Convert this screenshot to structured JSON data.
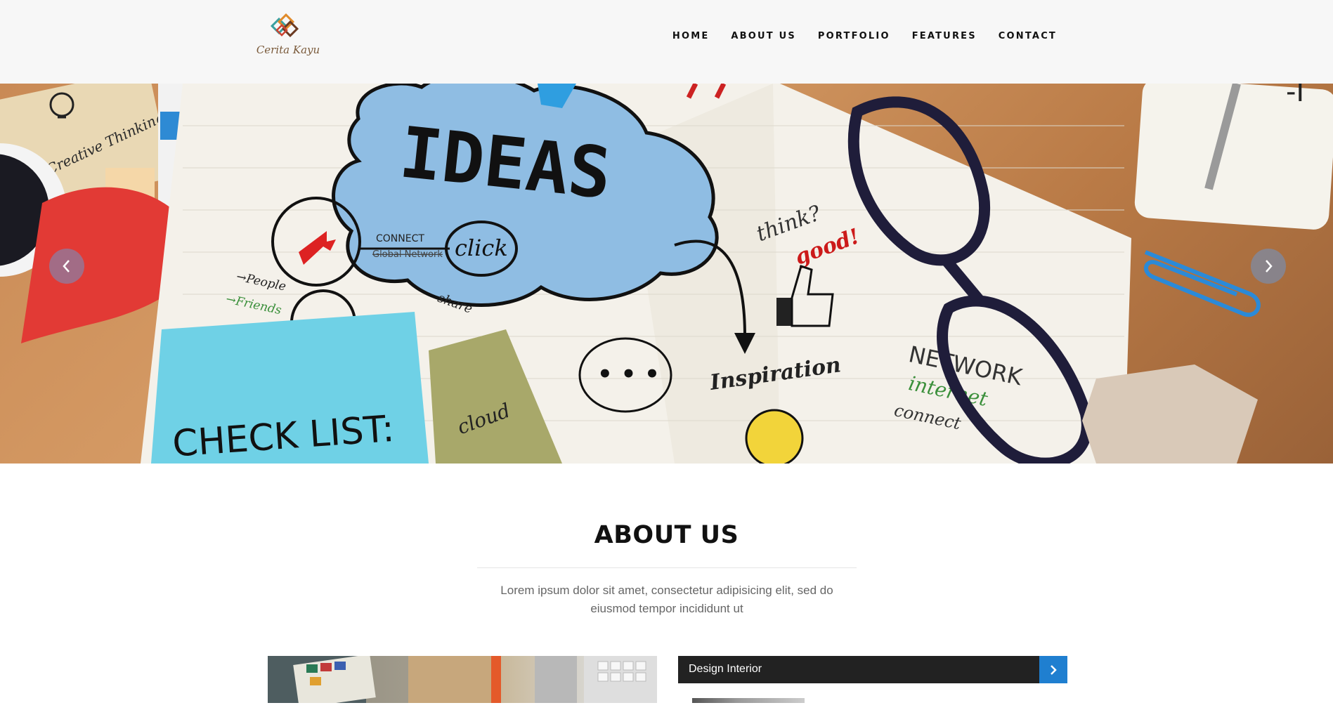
{
  "brand": {
    "name": "Cerita Kayu",
    "logo_icon": "diamond-squares-logo"
  },
  "nav": {
    "items": [
      {
        "label": "HOME"
      },
      {
        "label": "ABOUT US"
      },
      {
        "label": "PORTFOLIO"
      },
      {
        "label": "FEATURES"
      },
      {
        "label": "CONTACT"
      }
    ]
  },
  "hero": {
    "slide_texts": {
      "ideas": "IDEAS",
      "creative": "Creative Thinking",
      "connect": "CONNECT",
      "global": "Global Network",
      "click": "click",
      "people": "→People",
      "friends": "→Friends",
      "share": "share",
      "think": "think?",
      "good": "good!",
      "inspiration": "Inspiration",
      "network": "NETWORK",
      "internet": "internet",
      "connect2": "connect",
      "checklist": "CHECK LIST:",
      "cloud": "cloud"
    },
    "prev_icon": "chevron-left-icon",
    "next_icon": "chevron-right-icon",
    "accent_color": "#5b8fcf"
  },
  "about": {
    "title": "ABOUT US",
    "description": "Lorem ipsum dolor sit amet, consectetur adipisicing elit, sed do eiusmod tempor incididunt ut"
  },
  "accordion": {
    "title": "Design Interior",
    "icon": "chevron-right-icon",
    "header_color": "#222222",
    "button_color": "#1f7fd0"
  }
}
